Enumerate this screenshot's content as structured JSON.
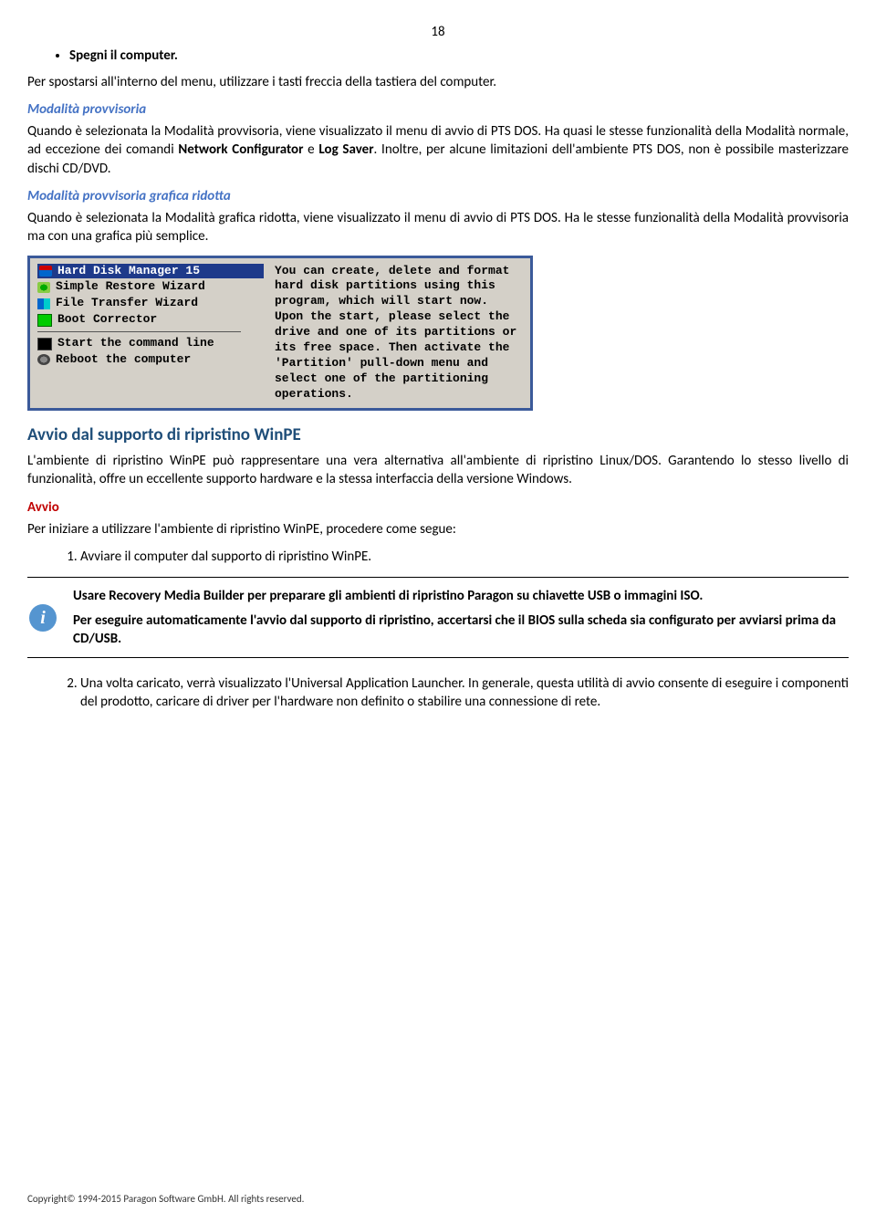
{
  "page_number": "18",
  "bullet_item": "Spegni il computer.",
  "p_intro": "Per spostarsi all'interno del menu, utilizzare i tasti freccia della tastiera del computer.",
  "h_provv": "Modalità provvisoria",
  "p_provv_a": "Quando è selezionata la Modalità provvisoria, viene visualizzato il menu di avvio di PTS DOS. Ha quasi le stesse funzionalità della Modalità normale, ad eccezione dei comandi ",
  "p_provv_b1": "Network Configurator",
  "p_provv_c": " e ",
  "p_provv_b2": "Log Saver",
  "p_provv_d": ". Inoltre, per alcune limitazioni dell'ambiente PTS DOS, non è possibile masterizzare dischi CD/DVD.",
  "h_ridotta": "Modalità provvisoria grafica ridotta",
  "p_ridotta": "Quando è selezionata la Modalità grafica ridotta, viene visualizzato il menu di avvio di PTS DOS. Ha le stesse funzionalità della Modalità provvisoria ma con una grafica più semplice.",
  "dos": {
    "m1": "Hard Disk Manager 15",
    "m2": "Simple Restore Wizard",
    "m3": "File Transfer Wizard",
    "m4": "Boot Corrector",
    "m5": "Start the command line",
    "m6": "Reboot the computer",
    "desc": "You can create, delete and format hard disk partitions using this program, which will start now.\nUpon the start, please select the drive and one of its partitions or its free space. Then activate the 'Partition' pull-down menu and select one of the partitioning operations."
  },
  "h_winpe": "Avvio dal supporto di ripristino WinPE",
  "p_winpe": "L'ambiente di ripristino WinPE può rappresentare una vera alternativa all'ambiente di ripristino Linux/DOS. Garantendo lo stesso livello di funzionalità, offre un eccellente supporto hardware e la stessa interfaccia della versione Windows.",
  "h_avvio": "Avvio",
  "p_avvio": "Per iniziare a utilizzare l'ambiente di ripristino WinPE, procedere come segue:",
  "li1": "Avviare il computer dal supporto di ripristino WinPE.",
  "note1": "Usare Recovery Media Builder per preparare gli ambienti di ripristino Paragon su chiavette USB o immagini ISO.",
  "note2": "Per eseguire automaticamente l'avvio dal supporto di ripristino, accertarsi che il BIOS sulla scheda sia configurato per avviarsi prima da CD/USB.",
  "li2": "Una volta caricato, verrà visualizzato l'Universal Application Launcher. In generale, questa utilità di avvio consente di eseguire i componenti del prodotto, caricare di driver per l'hardware non definito o stabilire una connessione di rete.",
  "footer": "Copyright© 1994-2015 Paragon Software GmbH. All rights reserved."
}
